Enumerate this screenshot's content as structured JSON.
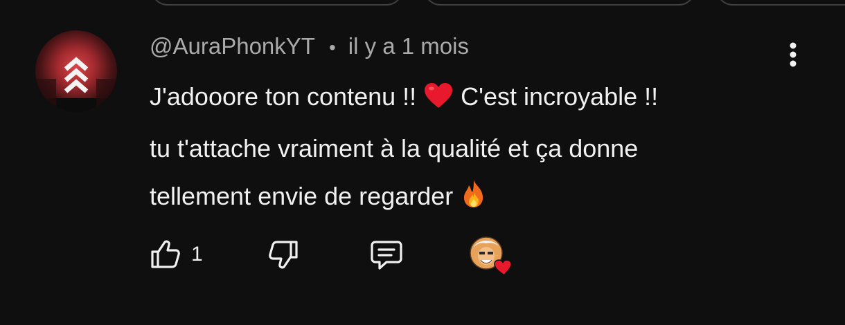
{
  "comment": {
    "author": "@AuraPhonkYT",
    "separator": "•",
    "timestamp": "il y a 1 mois",
    "text_line1": "J'adooore ton contenu !! ",
    "text_line1b": " C'est incroyable !!",
    "text_line2": "tu t'attache vraiment à la qualité et ça donne",
    "text_line3": "tellement envie de regarder ",
    "like_count": "1"
  },
  "colors": {
    "background": "#0f0f0f",
    "text": "#f1f1f1",
    "meta": "#aaaaaa",
    "heart": "#e8192c"
  },
  "icons": {
    "avatar": "aura-avatar",
    "more": "kebab-vertical-icon",
    "like": "thumbs-up-icon",
    "dislike": "thumbs-down-icon",
    "reply": "reply-comment-icon",
    "creator_heart": "creator-heart-badge"
  }
}
